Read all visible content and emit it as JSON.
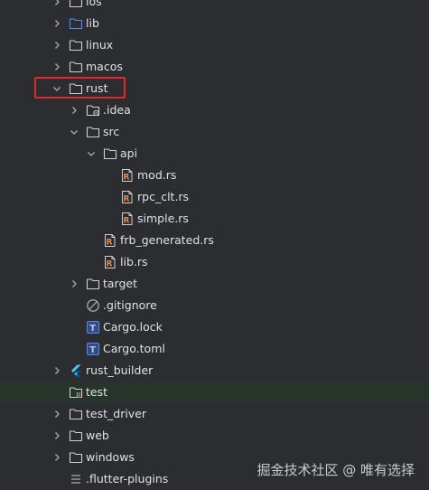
{
  "tree": {
    "items": [
      {
        "label": "ios",
        "kind": "folder",
        "depth": 0,
        "arrow": "right"
      },
      {
        "label": "lib",
        "kind": "folder-blue",
        "depth": 0,
        "arrow": "right"
      },
      {
        "label": "linux",
        "kind": "folder",
        "depth": 0,
        "arrow": "right"
      },
      {
        "label": "macos",
        "kind": "folder",
        "depth": 0,
        "arrow": "right"
      },
      {
        "label": "rust",
        "kind": "folder",
        "depth": 0,
        "arrow": "down"
      },
      {
        "label": ".idea",
        "kind": "folder-config",
        "depth": 1,
        "arrow": "right"
      },
      {
        "label": "src",
        "kind": "folder",
        "depth": 1,
        "arrow": "down"
      },
      {
        "label": "api",
        "kind": "folder",
        "depth": 2,
        "arrow": "down"
      },
      {
        "label": "mod.rs",
        "kind": "rust-file",
        "depth": 3,
        "arrow": "none"
      },
      {
        "label": "rpc_clt.rs",
        "kind": "rust-file",
        "depth": 3,
        "arrow": "none"
      },
      {
        "label": "simple.rs",
        "kind": "rust-file",
        "depth": 3,
        "arrow": "none"
      },
      {
        "label": "frb_generated.rs",
        "kind": "rust-file",
        "depth": 2,
        "arrow": "none"
      },
      {
        "label": "lib.rs",
        "kind": "rust-file",
        "depth": 2,
        "arrow": "none"
      },
      {
        "label": "target",
        "kind": "folder",
        "depth": 1,
        "arrow": "right"
      },
      {
        "label": ".gitignore",
        "kind": "ignore-file",
        "depth": 1,
        "arrow": "none"
      },
      {
        "label": "Cargo.lock",
        "kind": "text-file",
        "depth": 1,
        "arrow": "none"
      },
      {
        "label": "Cargo.toml",
        "kind": "text-file",
        "depth": 1,
        "arrow": "none"
      },
      {
        "label": "rust_builder",
        "kind": "flutter-module",
        "depth": 0,
        "arrow": "right"
      },
      {
        "label": "test",
        "kind": "folder-test",
        "depth": 0,
        "arrow": "none",
        "highlighted": true
      },
      {
        "label": "test_driver",
        "kind": "folder",
        "depth": 0,
        "arrow": "right"
      },
      {
        "label": "web",
        "kind": "folder",
        "depth": 0,
        "arrow": "right"
      },
      {
        "label": "windows",
        "kind": "folder",
        "depth": 0,
        "arrow": "right"
      },
      {
        "label": ".flutter-plugins",
        "kind": "list-file",
        "depth": 0,
        "arrow": "none"
      }
    ]
  },
  "annotation": {
    "target": "rust",
    "color": "#e0272b"
  },
  "watermark": "掘金技术社区 @ 唯有选择",
  "colors": {
    "background": "#2b2d30",
    "text": "#dfe1e5",
    "folder_outline": "#ced0d6",
    "folder_blue": "#548af7",
    "file_blue": "#548af7",
    "row_highlight": "#28332b",
    "annotation_box": "#e0272b"
  }
}
